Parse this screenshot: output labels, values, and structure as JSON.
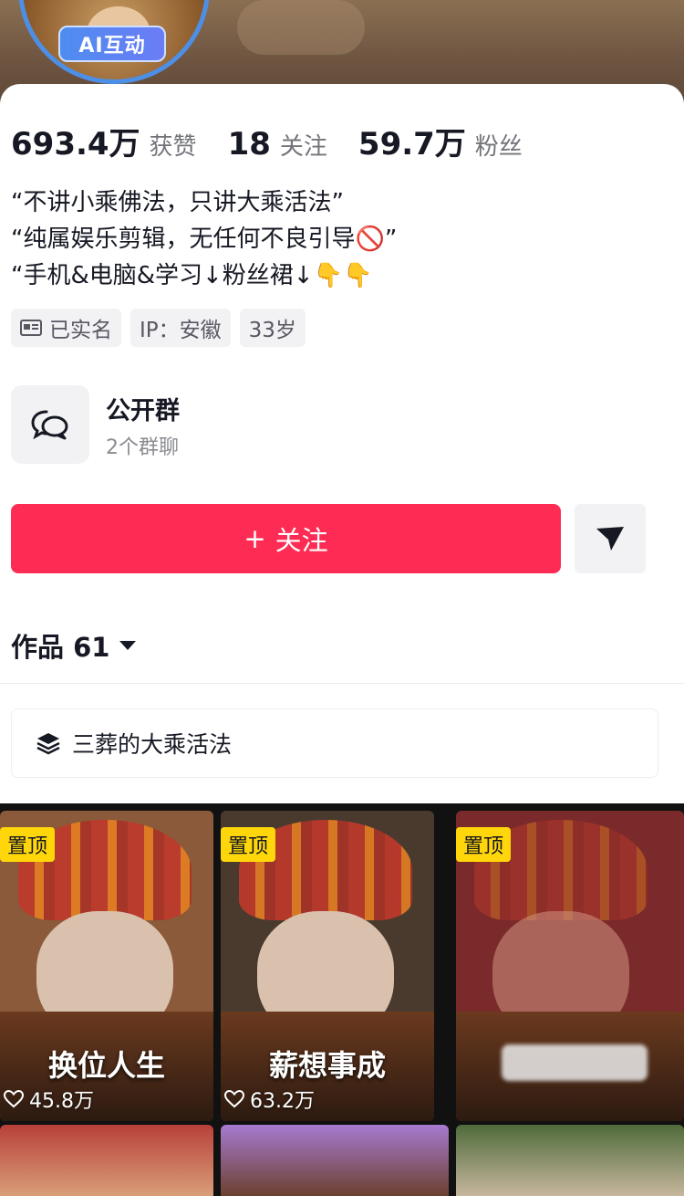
{
  "profile": {
    "ai_badge": "AI互动",
    "stats": [
      {
        "value": "693.4万",
        "label": "获赞"
      },
      {
        "value": "18",
        "label": "关注"
      },
      {
        "value": "59.7万",
        "label": "粉丝"
      }
    ],
    "bio": [
      "“不讲小乘佛法，只讲大乘活法”",
      "“纯属娱乐剪辑，无任何不良引导🚫”",
      "“手机&电脑&学习↓粉丝裙↓👇👇"
    ],
    "tags": [
      "已实名",
      "IP：安徽",
      "33岁"
    ]
  },
  "group": {
    "title": "公开群",
    "subtitle": "2个群聊",
    "icon": "chat-bubbles-icon"
  },
  "actions": {
    "follow_label": "关注",
    "follow_prefix": "+",
    "share_icon": "send-arrow-icon"
  },
  "works": {
    "label": "作品 61"
  },
  "collection": {
    "label": "三葬的大乘活法",
    "icon": "layers-icon"
  },
  "videos": [
    {
      "pinned": "置顶",
      "caption": "换位人生",
      "likes": "45.8万"
    },
    {
      "pinned": "置顶",
      "caption": "薪想事成",
      "likes": "63.2万"
    },
    {
      "pinned": "置顶",
      "caption": "",
      "likes": ""
    }
  ],
  "colors": {
    "follow": "#fe2c55",
    "pin": "#ffd60a",
    "badge": "#4f8df0"
  }
}
